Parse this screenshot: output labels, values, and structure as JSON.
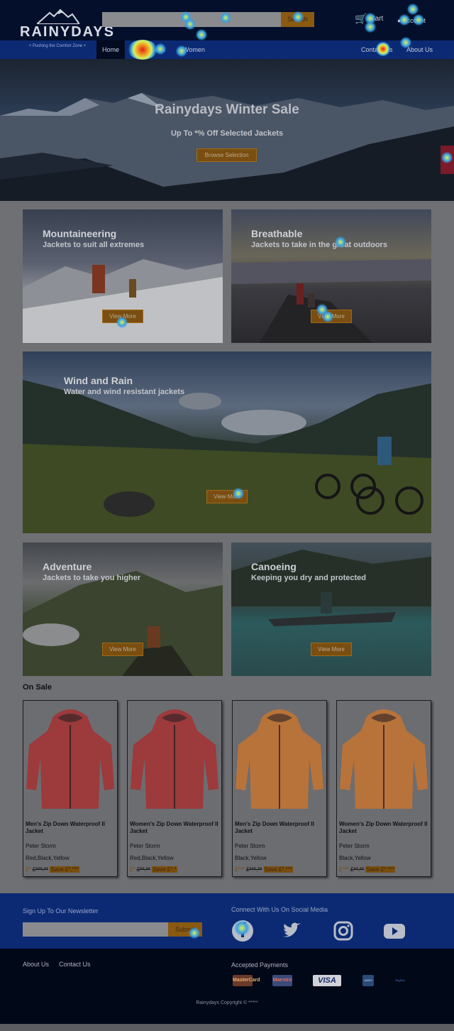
{
  "header": {
    "logo_text": "RAINYDAYS",
    "tagline": "× Pushing the Comfort Zone ×",
    "search_placeholder": "",
    "search_button": "Search",
    "cart_label": "Cart",
    "account_label": "Account"
  },
  "nav": {
    "left": [
      "Home",
      "Men",
      "Women"
    ],
    "right": [
      "Contact Us",
      "About Us"
    ]
  },
  "hero": {
    "title": "Rainydays Winter Sale",
    "subtitle": "Up To *% Off Selected Jackets",
    "button": "Browse Selection"
  },
  "categories": [
    {
      "title": "Mountaineering",
      "subtitle": "Jackets to suit all extremes",
      "button": "View More"
    },
    {
      "title": "Breathable",
      "subtitle": "Jackets to take in the great outdoors",
      "button": "View More"
    },
    {
      "title": "Wind and Rain",
      "subtitle": "Water and wind resistant jackets",
      "button": "View More"
    },
    {
      "title": "Adventure",
      "subtitle": "Jackets to take you higher",
      "button": "View More"
    },
    {
      "title": "Canoeing",
      "subtitle": "Keeping you dry and protected",
      "button": "View More"
    }
  ],
  "on_sale": {
    "heading": "On Sale",
    "products": [
      {
        "name": "Men's Zip Down Waterproof II Jacket",
        "brand": "Peter Storm",
        "colors": "Red,Black,Yellow",
        "price": "£*",
        "old_price": "£***.**",
        "save": "Save £*.***",
        "jacket_color": "#9c3a3c"
      },
      {
        "name": "Women's Zip Down Waterproof II Jacket",
        "brand": "Peter Storm",
        "colors": "Red,Black,Yellow",
        "price": "£*",
        "old_price": "£**.**",
        "save": "Save £*.*",
        "jacket_color": "#9c3a3c"
      },
      {
        "name": "Men's Zip Down Waterproof II Jacket",
        "brand": "Peter Storm",
        "colors": "Black,Yellow",
        "price": "£***",
        "old_price": "£***.**",
        "save": "Save £*.***",
        "jacket_color": "#b8733a"
      },
      {
        "name": "Women's Zip Down Waterproof II Jacket",
        "brand": "Peter Storm",
        "colors": "Black,Yellow",
        "price": "£***",
        "old_price": "£**.**",
        "save": "Save £*.***",
        "jacket_color": "#b8733a"
      }
    ]
  },
  "newsletter": {
    "heading": "Sign Up To Our Newsletter",
    "button": "Submit"
  },
  "social": {
    "heading": "Connect With Us On Social Media",
    "icons": [
      "facebook-icon",
      "twitter-icon",
      "instagram-icon",
      "youtube-icon"
    ]
  },
  "footer": {
    "links": [
      "About Us",
      "Contact Us"
    ],
    "payments_heading": "Accepted Payments",
    "payments": [
      "MasterCard",
      "Maestro",
      "VISA",
      "AMEX",
      "PayPal"
    ],
    "copyright": "Rainydays Copyright © *****"
  },
  "colors": {
    "header_bg": "#04102b",
    "nav_bg": "#0c2a74",
    "accent": "#7a4e10",
    "footer_bg": "#010817"
  }
}
